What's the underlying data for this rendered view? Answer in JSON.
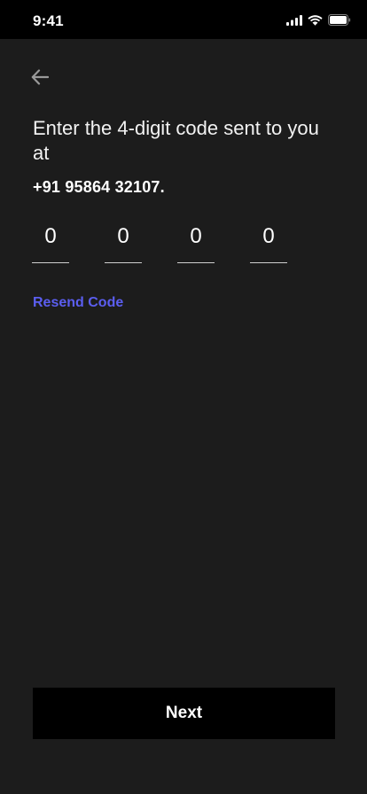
{
  "status_bar": {
    "time": "9:41",
    "icons": [
      "signal-icon",
      "wifi-icon",
      "battery-icon"
    ]
  },
  "nav": {
    "back_icon": "arrow-left-icon"
  },
  "verify": {
    "heading": "Enter the 4-digit code sent to you at",
    "phone": "+91 95864 32107.",
    "code_digits": [
      "0",
      "0",
      "0",
      "0"
    ],
    "resend_label": "Resend Code",
    "next_label": "Next"
  },
  "colors": {
    "background": "#1c1c1c",
    "status_bar": "#000000",
    "accent_link": "#5b5ef0",
    "button": "#000000"
  }
}
